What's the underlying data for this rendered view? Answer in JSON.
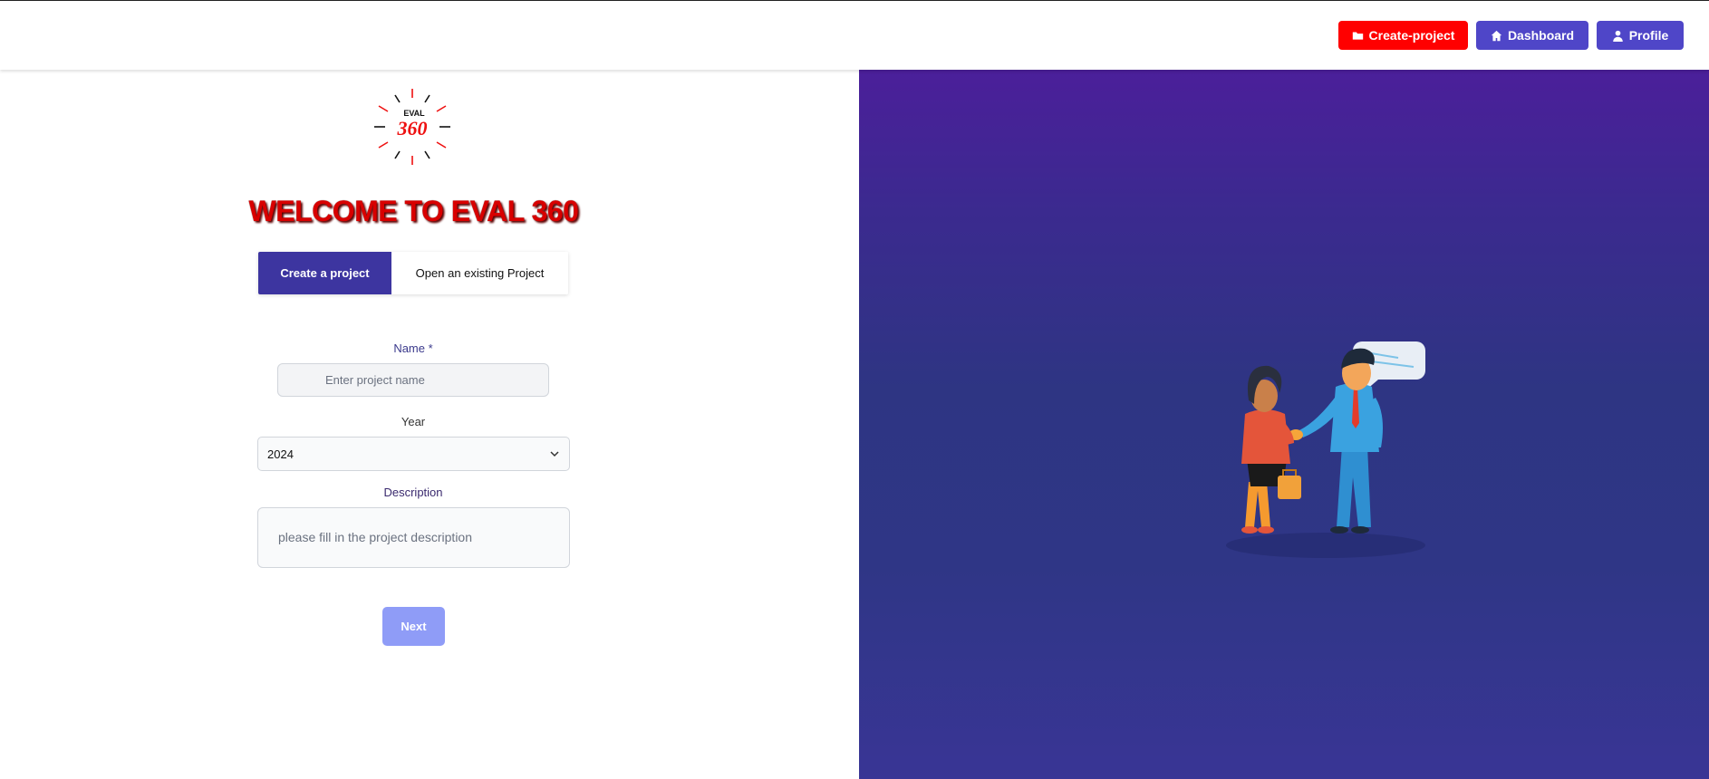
{
  "navbar": {
    "create_project_label": "Create-project",
    "dashboard_label": "Dashboard",
    "profile_label": "Profile"
  },
  "logo": {
    "small_text": "EVAL",
    "big_text": "360"
  },
  "welcome_title": "WELCOME TO EVAL 360",
  "tabs": {
    "create": "Create a project",
    "open": "Open an existing Project"
  },
  "form": {
    "name_label": "Name *",
    "name_placeholder": "Enter project name",
    "year_label": "Year",
    "year_value": "2024",
    "description_label": "Description",
    "description_placeholder": "please fill in the project description",
    "next_label": "Next"
  },
  "colors": {
    "create_button": "#ff0000",
    "nav_button": "#4f46c8",
    "active_tab": "#3d35a0",
    "next_button": "#8f9cf7",
    "title_red": "#d80000"
  }
}
